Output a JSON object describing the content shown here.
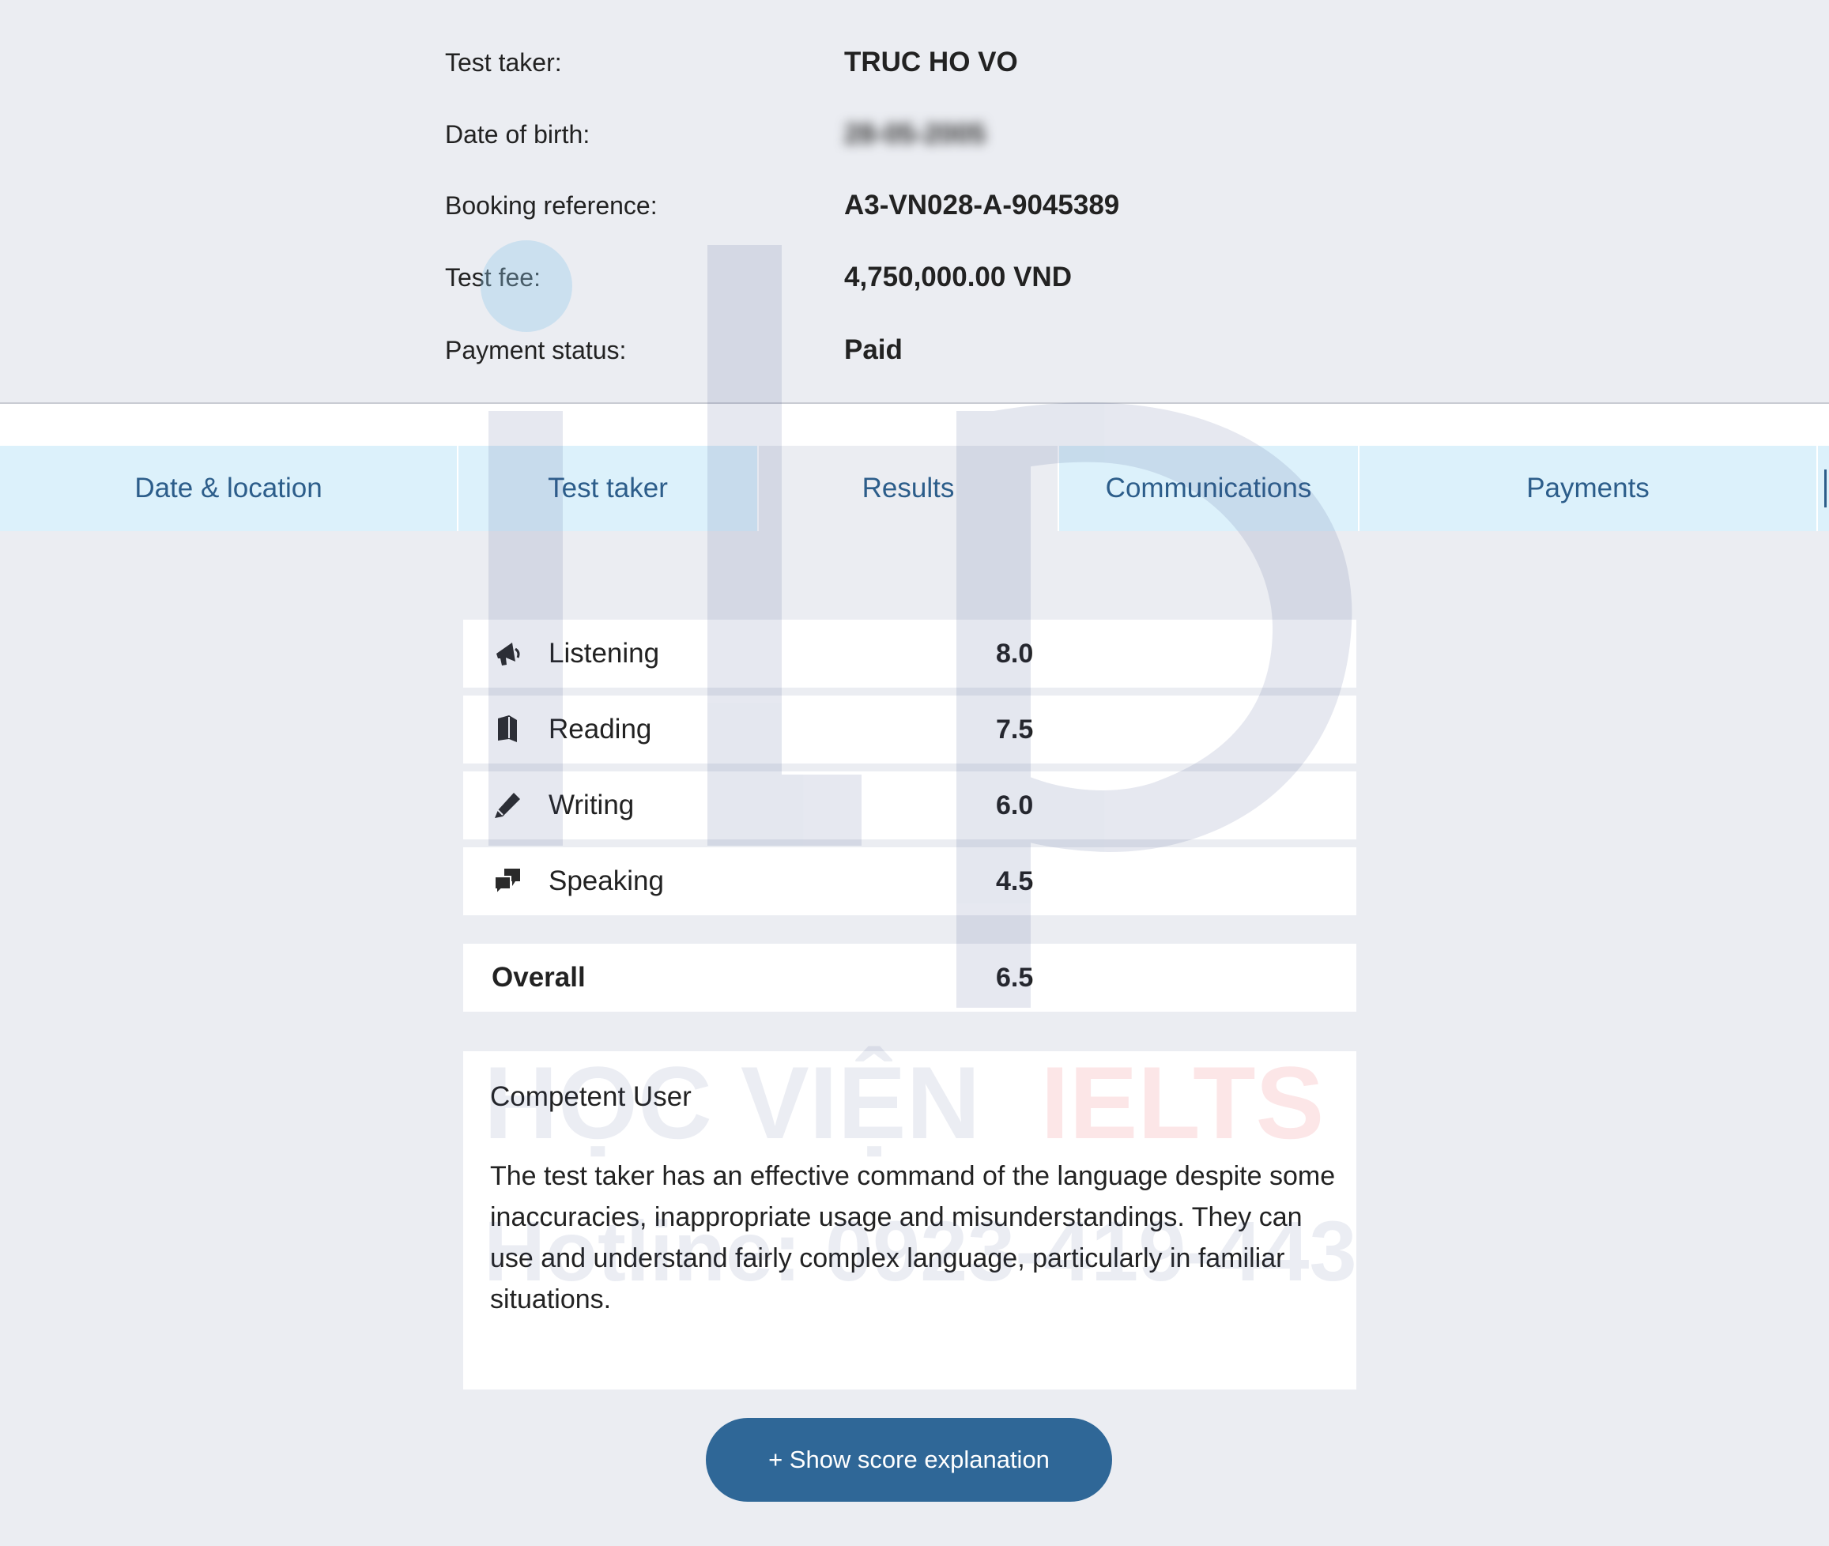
{
  "booking": {
    "rows": [
      {
        "label": "Test taker:",
        "value": "TRUC HO VO",
        "blurred": false
      },
      {
        "label": "Date of birth:",
        "value": "28-05-2005",
        "blurred": true
      },
      {
        "label": "Booking reference:",
        "value": "A3-VN028-A-9045389",
        "blurred": false
      },
      {
        "label": "Test fee:",
        "value": "4,750,000.00 VND",
        "blurred": false
      },
      {
        "label": "Payment status:",
        "value": "Paid",
        "blurred": false
      }
    ]
  },
  "tabs": [
    {
      "label": "Date & location",
      "active": false
    },
    {
      "label": "Test taker",
      "active": false
    },
    {
      "label": "Results",
      "active": true
    },
    {
      "label": "Communications",
      "active": false
    },
    {
      "label": "Payments",
      "active": false
    }
  ],
  "results": {
    "scores": [
      {
        "name": "Listening",
        "score": "8.0",
        "icon": "megaphone-icon"
      },
      {
        "name": "Reading",
        "score": "7.5",
        "icon": "book-icon"
      },
      {
        "name": "Writing",
        "score": "6.0",
        "icon": "pencil-icon"
      },
      {
        "name": "Speaking",
        "score": "4.5",
        "icon": "speech-bubbles-icon"
      }
    ],
    "overall": {
      "name": "Overall",
      "score": "6.5"
    },
    "level": "Competent User",
    "description": "The test taker has an effective command of the language despite some inaccuracies, inappropriate usage and misunderstandings. They can use and understand fairly complex language, particularly in familiar situations."
  },
  "button": {
    "label": "+ Show score explanation"
  },
  "watermark": {
    "brand_dark": "HỌC VIỆN",
    "brand_accent": "IELTS",
    "hotline": "Hotline: 0923-419-443",
    "color_dark": "#3a4f8a",
    "color_accent": "#e8333c"
  },
  "colors": {
    "page_bg": "#ebedf2",
    "tab_bg": "#dcf1fb",
    "tab_text": "#2c5d8a",
    "button_bg": "#2f6797"
  }
}
